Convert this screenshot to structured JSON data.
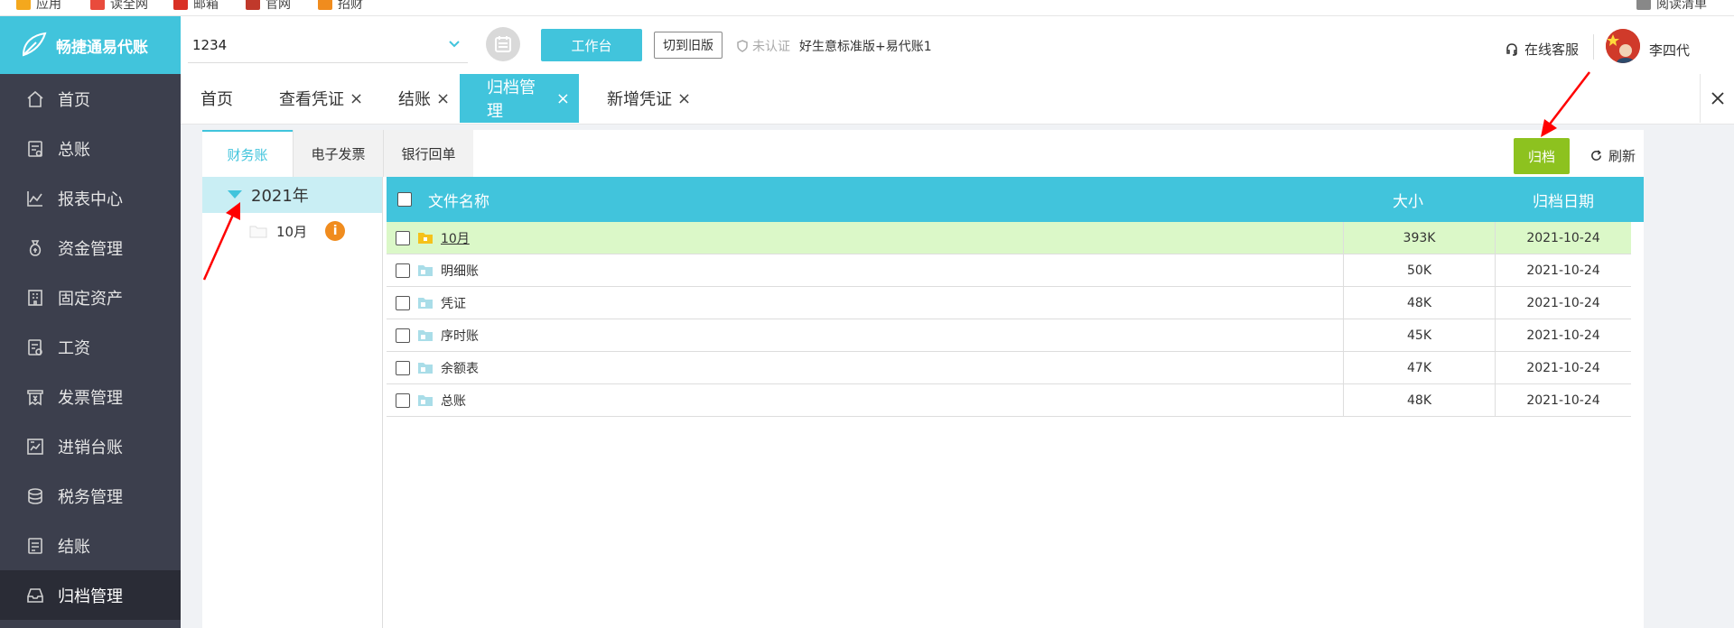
{
  "bookmarks": [
    {
      "label": "应用",
      "color": "#f4a81d"
    },
    {
      "label": "读全网",
      "color": "#e94b3c"
    },
    {
      "label": "邮箱",
      "color": "#d93025"
    },
    {
      "label": "官网",
      "color": "#c0392b"
    },
    {
      "label": "招财",
      "color": "#f08c1e"
    },
    {
      "label": "阅读清单",
      "color": "#888888"
    }
  ],
  "brand": {
    "name": "畅捷通易代账",
    "color": "#41c4dc"
  },
  "sidebar": {
    "items": [
      {
        "label": "首页",
        "icon": "home-icon"
      },
      {
        "label": "总账",
        "icon": "ledger-icon"
      },
      {
        "label": "报表中心",
        "icon": "chart-icon"
      },
      {
        "label": "资金管理",
        "icon": "money-bag-icon"
      },
      {
        "label": "固定资产",
        "icon": "building-icon"
      },
      {
        "label": "工资",
        "icon": "payroll-icon"
      },
      {
        "label": "发票管理",
        "icon": "invoice-icon"
      },
      {
        "label": "进销台账",
        "icon": "inventory-icon"
      },
      {
        "label": "税务管理",
        "icon": "tax-icon"
      },
      {
        "label": "结账",
        "icon": "checkout-icon"
      },
      {
        "label": "归档管理",
        "icon": "archive-icon",
        "active": true
      }
    ]
  },
  "header": {
    "company_value": "1234",
    "workbench_label": "工作台",
    "old_version_label": "切到旧版",
    "uncertified_label": "未认证",
    "account_name": "好生意标准版+易代账1",
    "support_label": "在线客服",
    "username": "李四代"
  },
  "tabs": [
    {
      "label": "首页",
      "closable": false
    },
    {
      "label": "查看凭证",
      "closable": true
    },
    {
      "label": "结账",
      "closable": true
    },
    {
      "label": "归档管理",
      "closable": true,
      "active": true
    },
    {
      "label": "新增凭证",
      "closable": true
    }
  ],
  "subtabs": [
    {
      "label": "财务账",
      "active": true
    },
    {
      "label": "电子发票"
    },
    {
      "label": "银行回单"
    }
  ],
  "actions": {
    "archive_label": "归档",
    "refresh_label": "刷新"
  },
  "tree": {
    "year": "2021年",
    "months": [
      {
        "label": "10月",
        "info": "i"
      }
    ]
  },
  "table": {
    "columns": [
      "文件名称",
      "大小",
      "归档日期"
    ],
    "rows": [
      {
        "name": "10月",
        "size": "393K",
        "date": "2021-10-24",
        "type": "folder",
        "highlight": true
      },
      {
        "name": "明细账",
        "size": "50K",
        "date": "2021-10-24",
        "type": "file"
      },
      {
        "name": "凭证",
        "size": "48K",
        "date": "2021-10-24",
        "type": "file"
      },
      {
        "name": "序时账",
        "size": "45K",
        "date": "2021-10-24",
        "type": "file"
      },
      {
        "name": "余额表",
        "size": "47K",
        "date": "2021-10-24",
        "type": "file"
      },
      {
        "name": "总账",
        "size": "48K",
        "date": "2021-10-24",
        "type": "file"
      }
    ]
  },
  "colors": {
    "accent": "#41c4dc",
    "archive": "#8dc21f",
    "highlight_row": "#dbf8c8",
    "annotation": "#ff0000"
  }
}
